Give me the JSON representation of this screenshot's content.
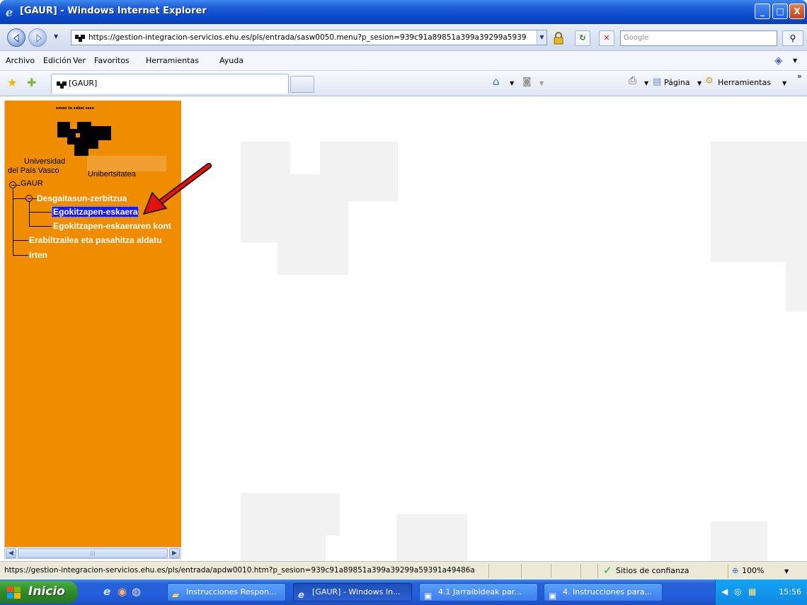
{
  "window": {
    "title": "[GAUR] - Windows Internet Explorer",
    "min_label": "_",
    "max_label": "□",
    "close_label": "X"
  },
  "address": {
    "url": "https://gestion-integracion-servicios.ehu.es/pls/entrada/sasw0050.menu?p_sesion=939c91a89851a399a39299a5939",
    "search_placeholder": "Google"
  },
  "menu": [
    "Archivo",
    "Edición",
    "Ver",
    "Favoritos",
    "Herramientas",
    "Ayuda"
  ],
  "tab": {
    "label": "[GAUR]"
  },
  "commands": {
    "page": "Página",
    "tools": "Herramientas"
  },
  "sidebar": {
    "logo_text": "eman ta zabal zazu",
    "university_es_1": "Universidad",
    "university_es_2": "del País Vasco",
    "university_eu": "Unibertsitatea",
    "tree": {
      "root": "GAUR",
      "group": "Desgaitasun-zerbitzua",
      "item1": "Egokitzapen-eskaera",
      "item2": "Egokitzapen-eskaeraren kont",
      "item3": "Erabiltzailea eta pasahitza aldatu",
      "item4": "Irten"
    }
  },
  "status": {
    "url": "https://gestion-integracion-servicios.ehu.es/pls/entrada/apdw0010.htm?p_sesion=939c91a89851a399a39299a59391a49486a",
    "zone": "Sitios de confianza",
    "zoom": "100%"
  },
  "taskbar": {
    "start_label": "Inicio",
    "tasks": [
      "Instrucciones Respon...",
      "[GAUR] - Windows In...",
      "4.1 Jarraibideak par...",
      "4. Instrucciones para..."
    ],
    "clock": "15:56"
  },
  "colors": {
    "sidebar_bg": "#ef8c00",
    "selected_bg": "#1a1aff",
    "titlebar": "#0a48c9",
    "arrow": "#e41010"
  }
}
